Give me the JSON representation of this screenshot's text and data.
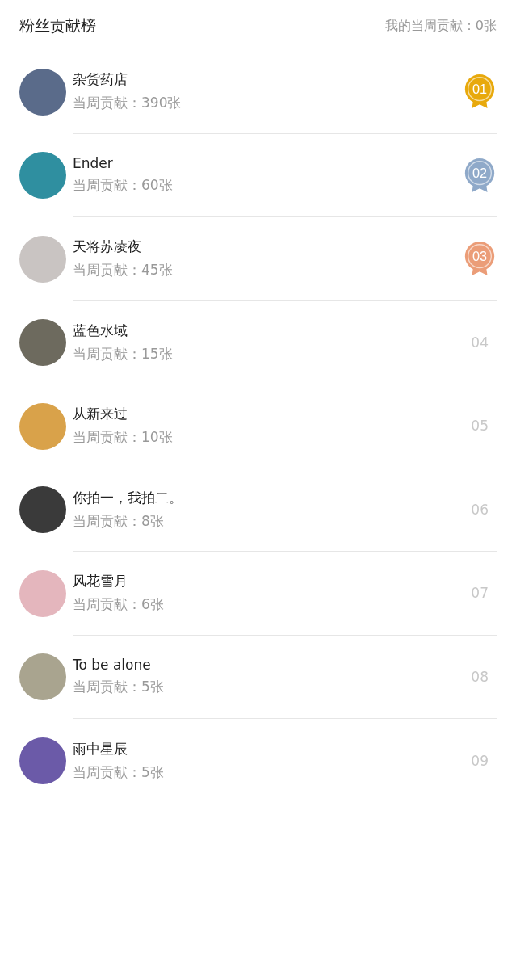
{
  "header": {
    "title": "粉丝贡献榜",
    "my_contribution": "我的当周贡献：0张"
  },
  "rows": [
    {
      "name": "杂货药店",
      "reading": "当周贡献：390张",
      "rank": "01",
      "kind": "medal",
      "color": "#e8a90c"
    },
    {
      "name": "Ender",
      "reading": "当周贡献：60张",
      "rank": "02",
      "kind": "medal",
      "color": "#8fa9c9"
    },
    {
      "name": "天将苏凌夜",
      "reading": "当周贡献：45张",
      "rank": "03",
      "kind": "medal",
      "color": "#eb9d78"
    },
    {
      "name": "蓝色水域",
      "reading": "当周贡献：15张",
      "rank": "04",
      "kind": "plain"
    },
    {
      "name": "从新来过",
      "reading": "当周贡献：10张",
      "rank": "05",
      "kind": "plain"
    },
    {
      "name": "你拍一，我拍二。",
      "reading": "当周贡献：8张",
      "rank": "06",
      "kind": "plain"
    },
    {
      "name": "风花雪月",
      "reading": "当周贡献：6张",
      "rank": "07",
      "kind": "plain"
    },
    {
      "name": "To be alone",
      "reading": "当周贡献：5张",
      "rank": "08",
      "kind": "plain"
    },
    {
      "name": "雨中星辰",
      "reading": "当周贡献：5张",
      "rank": "09",
      "kind": "plain"
    }
  ]
}
